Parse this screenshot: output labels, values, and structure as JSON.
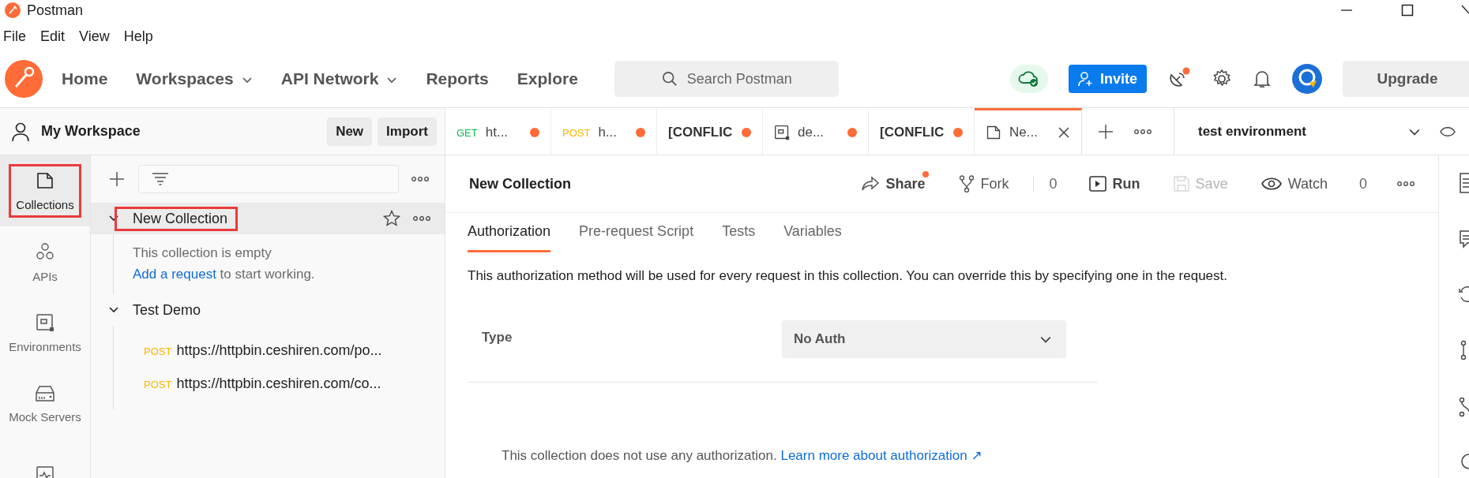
{
  "window": {
    "title": "Postman"
  },
  "menu": [
    "File",
    "Edit",
    "View",
    "Help"
  ],
  "nav": {
    "items": [
      {
        "label": "Home",
        "dropdown": false
      },
      {
        "label": "Workspaces",
        "dropdown": true
      },
      {
        "label": "API Network",
        "dropdown": true
      },
      {
        "label": "Reports",
        "dropdown": false
      },
      {
        "label": "Explore",
        "dropdown": false
      }
    ],
    "search": {
      "placeholder": "Search Postman"
    },
    "invite": "Invite",
    "upgrade": "Upgrade",
    "satellite_dot": true
  },
  "workspace": {
    "name": "My Workspace",
    "buttons": [
      "New",
      "Import"
    ]
  },
  "sidebar": {
    "items": [
      {
        "kind": "collections",
        "label": "Collections",
        "selected": true,
        "highlighted": true
      },
      {
        "kind": "apis",
        "label": "APIs",
        "selected": false,
        "highlighted": false
      },
      {
        "kind": "environments",
        "label": "Environments",
        "selected": false,
        "highlighted": false
      },
      {
        "kind": "mock_servers",
        "label": "Mock Servers",
        "selected": false,
        "highlighted": false
      },
      {
        "kind": "monitors",
        "selected": false,
        "highlighted": false
      }
    ]
  },
  "tree": [
    {
      "name": "New Collection",
      "expanded": true,
      "selected": true,
      "highlighted": true,
      "starred": false,
      "empty": {
        "message": "This collection is empty",
        "link": "Add a request",
        "after": "to start working."
      }
    },
    {
      "name": "Test Demo",
      "expanded": true,
      "selected": false,
      "highlighted": false,
      "children": [
        {
          "method": "POST",
          "name": "https://httpbin.ceshiren.com/po..."
        },
        {
          "method": "POST",
          "name": "https://httpbin.ceshiren.com/co..."
        }
      ]
    }
  ],
  "tabs": [
    {
      "kind": "request",
      "method": "GET",
      "label": "ht...",
      "unsaved": true,
      "selected": false
    },
    {
      "kind": "request",
      "method": "POST",
      "label": "h...",
      "unsaved": true,
      "selected": false
    },
    {
      "kind": "conflict",
      "label": "[CONFLIC",
      "unsaved": true,
      "selected": false
    },
    {
      "kind": "environment",
      "label": "de...",
      "unsaved": true,
      "selected": false
    },
    {
      "kind": "conflict",
      "label": "[CONFLIC",
      "unsaved": true,
      "selected": false
    },
    {
      "kind": "collection",
      "label": "Ne...",
      "unsaved": false,
      "selected": true
    }
  ],
  "environment": {
    "name": "test environment"
  },
  "collection": {
    "title": "New Collection",
    "actions": [
      {
        "kind": "share",
        "label": "Share",
        "dot": true,
        "disabled": false
      },
      {
        "kind": "fork",
        "label": "Fork",
        "count": "0",
        "disabled": false
      },
      {
        "kind": "run",
        "label": "Run",
        "disabled": false
      },
      {
        "kind": "save",
        "label": "Save",
        "disabled": true
      },
      {
        "kind": "watch",
        "label": "Watch",
        "count": "0",
        "disabled": false
      }
    ]
  },
  "subtabs": [
    {
      "label": "Authorization",
      "selected": true
    },
    {
      "label": "Pre-request Script",
      "selected": false
    },
    {
      "label": "Tests",
      "selected": false
    },
    {
      "label": "Variables",
      "selected": false
    }
  ],
  "auth": {
    "description": "This authorization method will be used for every request in this collection. You can override this by specifying one in the request.",
    "type_label": "Type",
    "type_value": "No Auth",
    "note": "This collection does not use any authorization.",
    "link": "Learn more about authorization ↗"
  }
}
